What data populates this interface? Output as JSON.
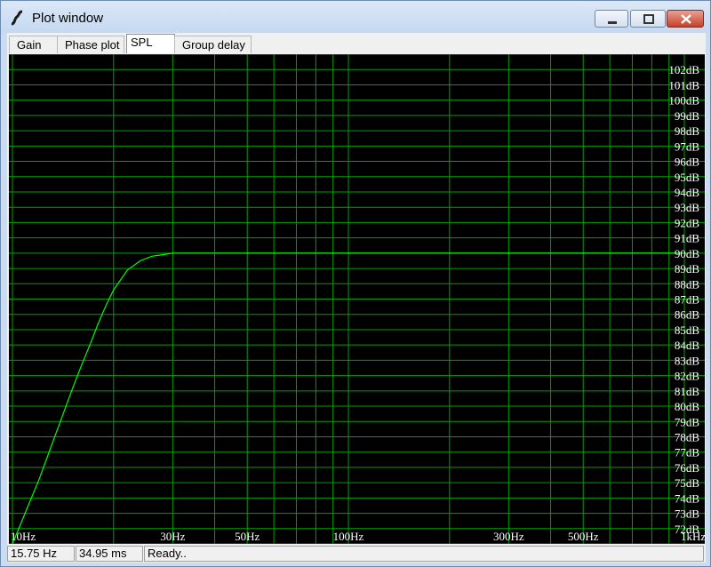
{
  "window": {
    "title": "Plot window"
  },
  "tabs": [
    {
      "label": "Gain"
    },
    {
      "label": "Phase plot"
    },
    {
      "label": "SPL"
    },
    {
      "label": "Group delay"
    }
  ],
  "status": {
    "frequency": "15.75 Hz",
    "time": "34.95 ms",
    "message": "Ready.."
  },
  "colors": {
    "plot_bg": "#000000",
    "grid": "#00a000",
    "curve": "#00ff00",
    "labels": "#ffffff"
  },
  "chart_data": {
    "type": "line",
    "x_scale": "log",
    "xlim": [
      10,
      1000
    ],
    "ylim": [
      71,
      103
    ],
    "x_ticks": [
      {
        "value": 10,
        "label": "10Hz"
      },
      {
        "value": 30,
        "label": "30Hz"
      },
      {
        "value": 50,
        "label": "50Hz"
      },
      {
        "value": 100,
        "label": "100Hz"
      },
      {
        "value": 300,
        "label": "300Hz"
      },
      {
        "value": 500,
        "label": "500Hz"
      },
      {
        "value": 1000,
        "label": "1kHz"
      }
    ],
    "y_tick_labels": [
      "102dB",
      "101dB",
      "100dB",
      "99dB",
      "98dB",
      "97dB",
      "96dB",
      "95dB",
      "94dB",
      "93dB",
      "92dB",
      "91dB",
      "90dB",
      "89dB",
      "88dB",
      "87dB",
      "86dB",
      "85dB",
      "84dB",
      "83dB",
      "82dB",
      "81dB",
      "80dB",
      "79dB",
      "78dB",
      "77dB",
      "76dB",
      "75dB",
      "74dB",
      "73dB",
      "72dB"
    ],
    "y_tick_values": [
      102,
      101,
      100,
      99,
      98,
      97,
      96,
      95,
      94,
      93,
      92,
      91,
      90,
      89,
      88,
      87,
      86,
      85,
      84,
      83,
      82,
      81,
      80,
      79,
      78,
      77,
      76,
      75,
      74,
      73,
      72
    ],
    "grid": true,
    "series": [
      {
        "x": [
          10,
          11,
          12,
          13,
          14,
          15,
          16,
          17,
          18,
          19,
          20,
          22,
          24,
          26,
          28,
          30,
          35,
          40,
          50,
          60,
          80,
          100,
          200,
          300,
          500,
          700,
          1000
        ],
        "y": [
          71.0,
          73.2,
          75.2,
          77.3,
          79.2,
          81.0,
          82.6,
          84.0,
          85.4,
          86.6,
          87.6,
          88.9,
          89.5,
          89.8,
          89.9,
          90.0,
          90.0,
          90.0,
          90.0,
          90.0,
          90.0,
          90.0,
          90.0,
          90.0,
          90.0,
          90.0,
          90.0
        ]
      }
    ]
  }
}
